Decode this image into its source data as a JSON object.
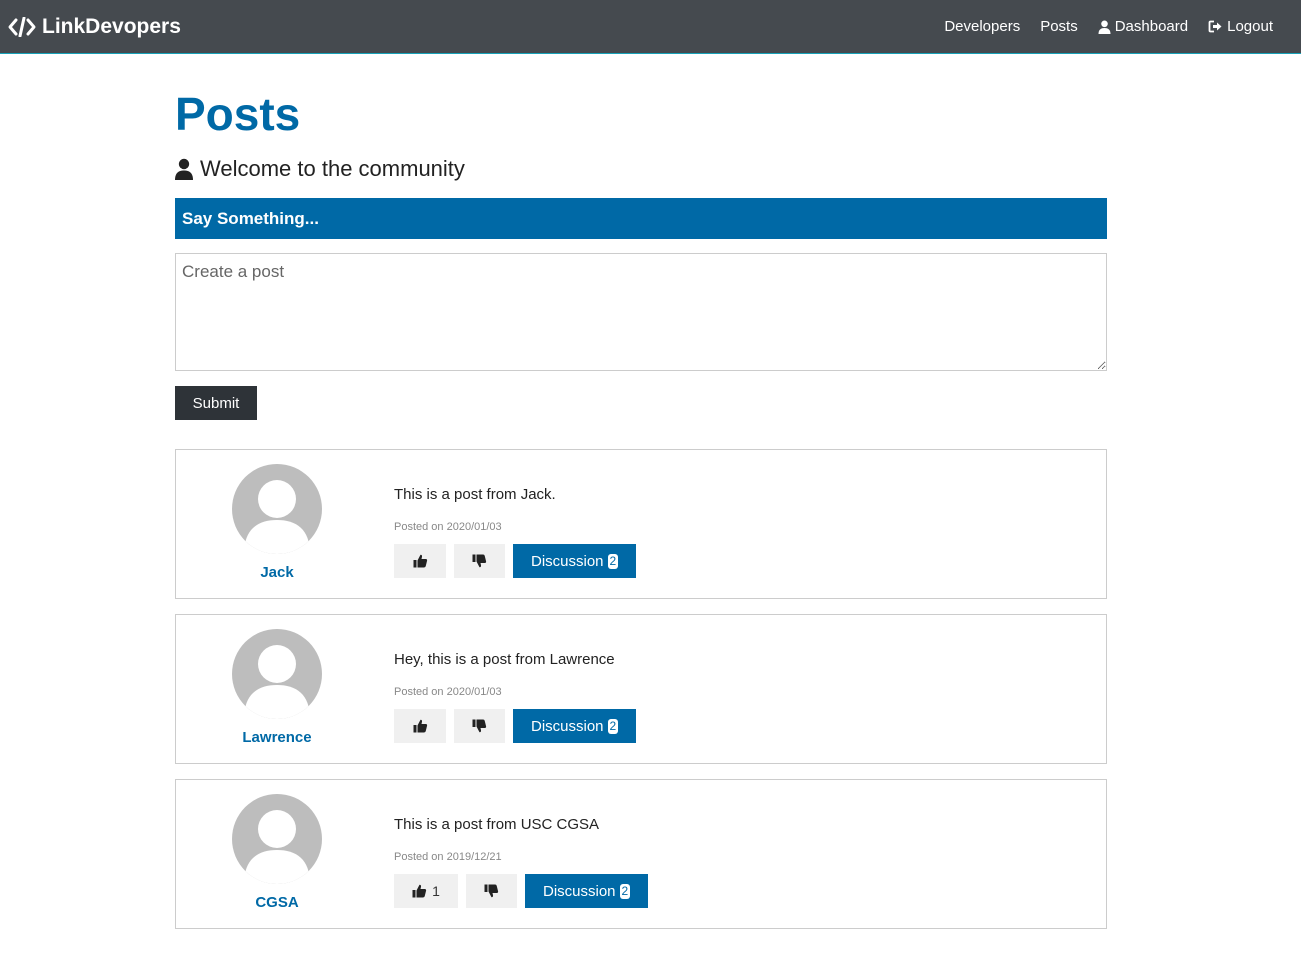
{
  "nav": {
    "brand": "LinkDevopers",
    "links": [
      {
        "label": "Developers"
      },
      {
        "label": "Posts"
      },
      {
        "label": "Dashboard",
        "icon": "user-icon"
      },
      {
        "label": "Logout",
        "icon": "sign-out-icon"
      }
    ]
  },
  "page": {
    "title": "Posts",
    "lead": "Welcome to the community"
  },
  "form": {
    "header": "Say Something...",
    "placeholder": "Create a post",
    "submit_label": "Submit"
  },
  "posts": [
    {
      "author": "Jack",
      "text": "This is a post from Jack.",
      "date": "Posted on 2020/01/03",
      "likes": "",
      "discussion_label": "Discussion",
      "comments": "2"
    },
    {
      "author": "Lawrence",
      "text": "Hey, this is a post from Lawrence",
      "date": "Posted on 2020/01/03",
      "likes": "",
      "discussion_label": "Discussion",
      "comments": "2"
    },
    {
      "author": "CGSA",
      "text": "This is a post from USC CGSA",
      "date": "Posted on 2019/12/21",
      "likes": "1",
      "discussion_label": "Discussion",
      "comments": "2"
    }
  ],
  "colors": {
    "primary": "#0069a6",
    "navbar": "#454a4f",
    "dark_button": "#2e3338",
    "light_button": "#f0f0f0",
    "avatar_gray": "#bdbdbd"
  }
}
